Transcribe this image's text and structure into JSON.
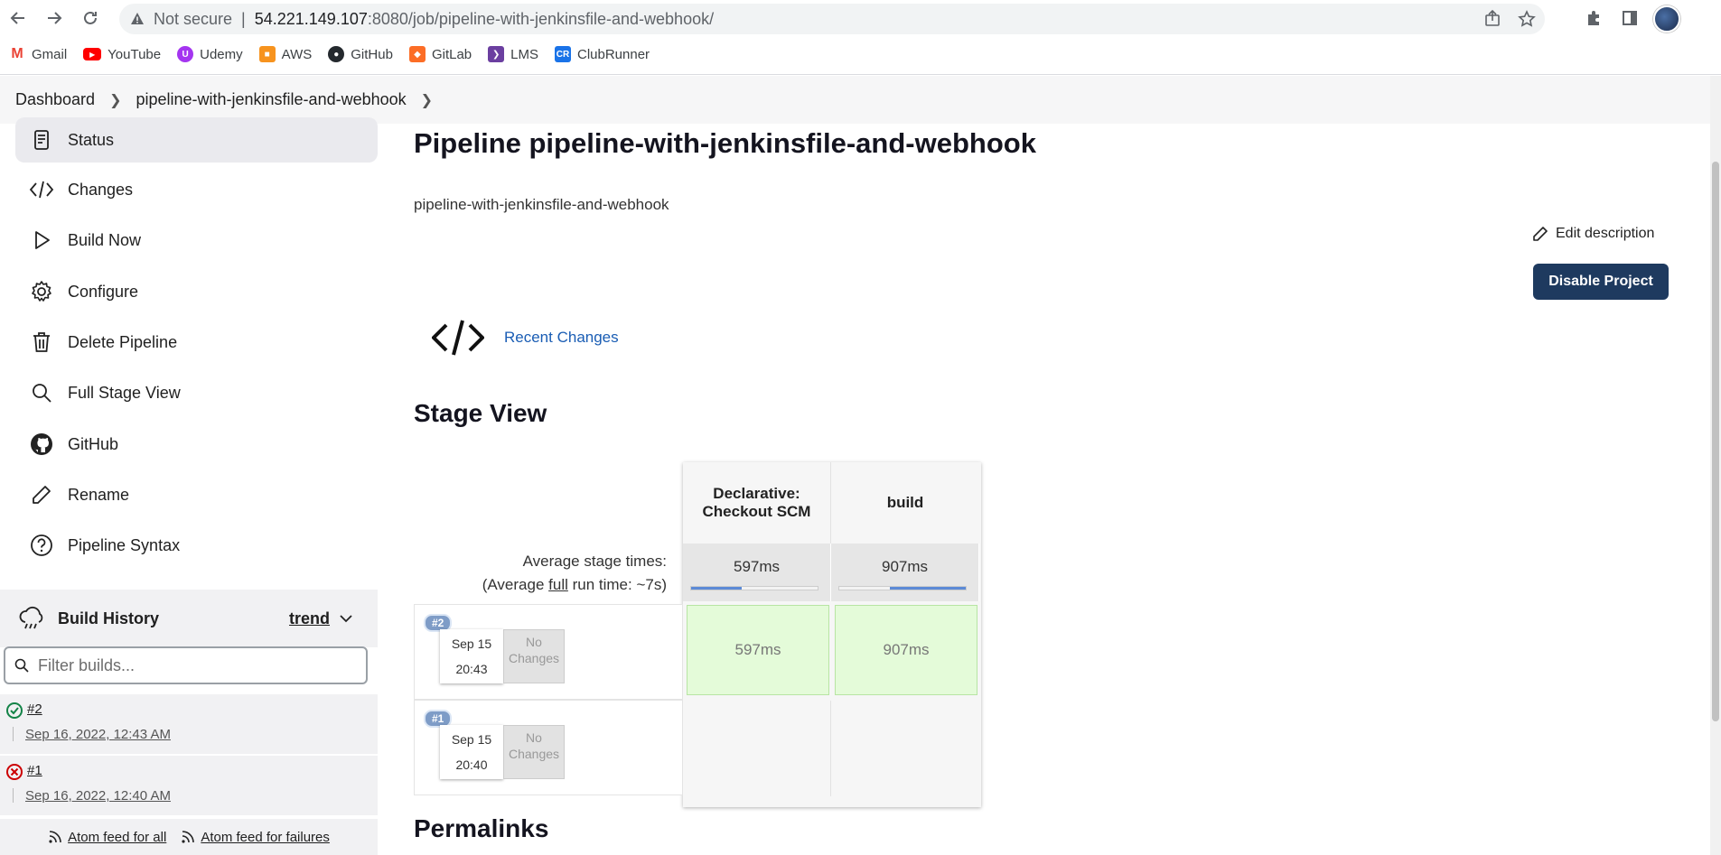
{
  "browser": {
    "security_label": "Not secure",
    "url_host": "54.221.149.107",
    "url_path": ":8080/job/pipeline-with-jenkinsfile-and-webhook/",
    "bookmarks": [
      {
        "label": "Gmail",
        "icon": "gmail-icon",
        "color": "#ea4335"
      },
      {
        "label": "YouTube",
        "icon": "youtube-icon",
        "color": "#ff0000"
      },
      {
        "label": "Udemy",
        "icon": "udemy-icon",
        "color": "#a435f0"
      },
      {
        "label": "AWS",
        "icon": "aws-icon",
        "color": "#f7931e"
      },
      {
        "label": "GitHub",
        "icon": "github-icon",
        "color": "#24292e"
      },
      {
        "label": "GitLab",
        "icon": "gitlab-icon",
        "color": "#fc6d26"
      },
      {
        "label": "LMS",
        "icon": "lms-icon",
        "color": "#6b3fa0"
      },
      {
        "label": "ClubRunner",
        "icon": "clubrunner-icon",
        "color": "#1a73e8"
      }
    ]
  },
  "breadcrumb": {
    "root": "Dashboard",
    "job": "pipeline-with-jenkinsfile-and-webhook"
  },
  "sidebar": {
    "items": [
      {
        "label": "Status",
        "icon": "document-icon"
      },
      {
        "label": "Changes",
        "icon": "code-icon"
      },
      {
        "label": "Build Now",
        "icon": "play-icon"
      },
      {
        "label": "Configure",
        "icon": "gear-icon"
      },
      {
        "label": "Delete Pipeline",
        "icon": "trash-icon"
      },
      {
        "label": "Full Stage View",
        "icon": "search-icon"
      },
      {
        "label": "GitHub",
        "icon": "github-icon"
      },
      {
        "label": "Rename",
        "icon": "pencil-icon"
      },
      {
        "label": "Pipeline Syntax",
        "icon": "help-icon"
      }
    ]
  },
  "build_history": {
    "title": "Build History",
    "trend_label": "trend",
    "filter_placeholder": "Filter builds...",
    "builds": [
      {
        "number": "#2",
        "date": "Sep 16, 2022, 12:43 AM",
        "status": "success"
      },
      {
        "number": "#1",
        "date": "Sep 16, 2022, 12:40 AM",
        "status": "failed"
      }
    ],
    "atom_all": "Atom feed for all",
    "atom_failures": "Atom feed for failures"
  },
  "main": {
    "title": "Pipeline pipeline-with-jenkinsfile-and-webhook",
    "description": "pipeline-with-jenkinsfile-and-webhook",
    "edit_description": "Edit description",
    "disable_project": "Disable Project",
    "recent_changes": "Recent Changes",
    "stage_view_title": "Stage View",
    "permalinks_title": "Permalinks"
  },
  "stage_view": {
    "stages": [
      {
        "name_line1": "Declarative:",
        "name_line2": "Checkout SCM",
        "average": "597ms",
        "avg_fill_start": 0.0,
        "avg_fill_fraction": 0.4
      },
      {
        "name_line1": "build",
        "name_line2": "",
        "average": "907ms",
        "avg_fill_start": 0.4,
        "avg_fill_fraction": 0.6
      }
    ],
    "avg_label_prefix": "Average stage times:",
    "avg_run_pre": "(Average ",
    "avg_run_full": "full",
    "avg_run_post": " run time: ~7s)",
    "runs": [
      {
        "badge": "#2",
        "date": "Sep 15",
        "time": "20:43",
        "no_changes_1": "No",
        "no_changes_2": "Changes",
        "cells": [
          "597ms",
          "907ms"
        ]
      },
      {
        "badge": "#1",
        "date": "Sep 15",
        "time": "20:40",
        "no_changes_1": "No",
        "no_changes_2": "Changes",
        "cells": []
      }
    ]
  }
}
